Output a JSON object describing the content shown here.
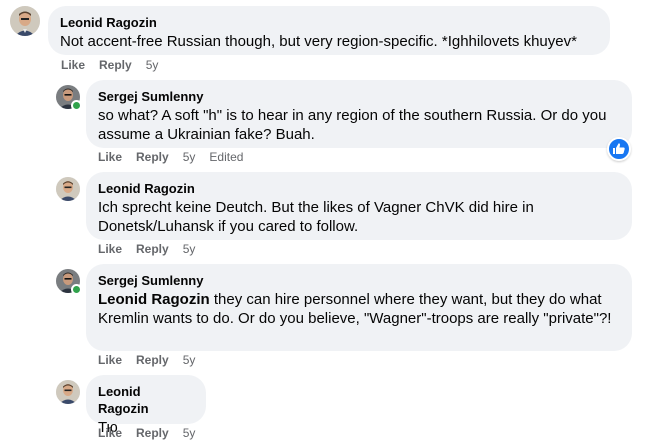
{
  "comments": [
    {
      "author": "Leonid Ragozin",
      "text": "Not accent-free Russian though, but very region-specific. *Ighhilovets khuyev*",
      "like_label": "Like",
      "reply_label": "Reply",
      "time": "5y"
    },
    {
      "author": "Sergej Sumlenny",
      "text": "so what? A soft \"h\" is to hear in any region of the southern Russia. Or do you assume a Ukrainian fake? Buah.",
      "like_label": "Like",
      "reply_label": "Reply",
      "time": "5y",
      "edited": "Edited"
    },
    {
      "author": "Leonid Ragozin",
      "text": "Ich sprecht keine Deutch. But the likes of Vagner ChVK did hire in Donetsk/Luhansk if you cared to follow.",
      "like_label": "Like",
      "reply_label": "Reply",
      "time": "5y"
    },
    {
      "author": "Sergej Sumlenny",
      "mention": "Leonid Ragozin",
      "text": " they can hire personnel where they want, but they do what Kremlin wants to do. Or do you believe, \"Wagner\"-troops are really \"private\"?!",
      "like_label": "Like",
      "reply_label": "Reply",
      "time": "5y"
    },
    {
      "author": "Leonid Ragozin",
      "text": "Тю",
      "like_label": "Like",
      "reply_label": "Reply",
      "time": "5y"
    }
  ],
  "colors": {
    "bubble": "#f0f2f5",
    "meta_text": "#65676b",
    "like_blue": "#1877f2",
    "online_green": "#31a24c"
  },
  "icons": {
    "avatar_leonid": "avatar-leonid-icon",
    "avatar_sergej": "avatar-sergej-icon",
    "reaction": "like-thumb-icon"
  }
}
